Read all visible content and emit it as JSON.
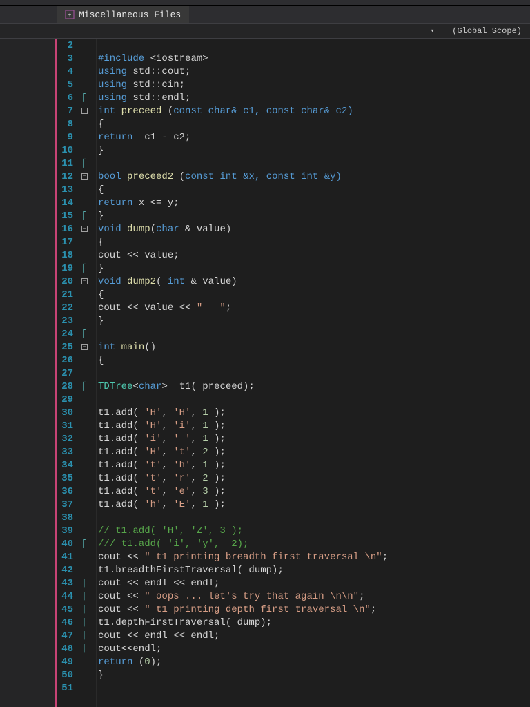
{
  "tab": {
    "label": "Miscellaneous Files"
  },
  "scope": {
    "label": "(Global Scope)"
  },
  "lines": {
    "start": 2,
    "end": 51
  },
  "code": {
    "l3": {
      "include": "#include",
      "lt": "<",
      "lib": "iostream",
      "gt": ">"
    },
    "l4": {
      "using": "using",
      "ns": "std::cout",
      "semi": ";"
    },
    "l5": {
      "using": "using",
      "ns": "std::cin",
      "semi": ";"
    },
    "l6": {
      "using": "using",
      "ns": "std::endl",
      "semi": ";"
    },
    "l7": {
      "type": "int",
      "fn": "preceed",
      "sig1": " (",
      "const1": "const",
      "char1": " char& c1, ",
      "const2": "const",
      "char2": " char& c2)"
    },
    "l8": {
      "brace": "{"
    },
    "l9": {
      "ret": "return",
      "expr": "  c1 - c2;"
    },
    "l10": {
      "brace": "}"
    },
    "l12": {
      "type": "bool",
      "fn": "preceed2",
      "sig1": " (",
      "const1": "const",
      "sig2": " int &x, ",
      "const2": "const",
      "sig3": " int &y)"
    },
    "l13": {
      "brace": "{"
    },
    "l14": {
      "ret": "return",
      "expr": " x <= y;"
    },
    "l15": {
      "brace": "}"
    },
    "l16": {
      "type": "void",
      "fn": "dump",
      "sig": "(",
      "ptype": "char",
      "rest": " & value)"
    },
    "l17": {
      "brace": "{"
    },
    "l18": {
      "out": "cout << value;"
    },
    "l19": {
      "brace": "}"
    },
    "l20": {
      "type": "void",
      "fn": "dump2",
      "sig": "( ",
      "ptype": "int",
      "rest": " & value)"
    },
    "l21": {
      "brace": "{"
    },
    "l22": {
      "out1": "cout << value << ",
      "str": "\"   \"",
      "out2": ";"
    },
    "l23": {
      "brace": "}"
    },
    "l25": {
      "type": "int",
      "fn": "main",
      "sig": "()"
    },
    "l26": {
      "brace": "{"
    },
    "l28": {
      "cls": "TDTree",
      "tpl1": "<",
      "tparam": "char",
      "tpl2": ">",
      "rest": "  t1( preceed);"
    },
    "l30": {
      "obj": "t1.add( ",
      "a": "'H'",
      "c1": ", ",
      "b": "'H'",
      "c2": ", ",
      "n": "1",
      "end": " );"
    },
    "l31": {
      "obj": "t1.add( ",
      "a": "'H'",
      "c1": ", ",
      "b": "'i'",
      "c2": ", ",
      "n": "1",
      "end": " );"
    },
    "l32": {
      "obj": "t1.add( ",
      "a": "'i'",
      "c1": ", ",
      "b": "' '",
      "c2": ", ",
      "n": "1",
      "end": " );"
    },
    "l33": {
      "obj": "t1.add( ",
      "a": "'H'",
      "c1": ", ",
      "b": "'t'",
      "c2": ", ",
      "n": "2",
      "end": " );"
    },
    "l34": {
      "obj": "t1.add( ",
      "a": "'t'",
      "c1": ", ",
      "b": "'h'",
      "c2": ", ",
      "n": "1",
      "end": " );"
    },
    "l35": {
      "obj": "t1.add( ",
      "a": "'t'",
      "c1": ", ",
      "b": "'r'",
      "c2": ", ",
      "n": "2",
      "end": " );"
    },
    "l36": {
      "obj": "t1.add( ",
      "a": "'t'",
      "c1": ", ",
      "b": "'e'",
      "c2": ", ",
      "n": "3",
      "end": " );"
    },
    "l37": {
      "obj": "t1.add( ",
      "a": "'h'",
      "c1": ", ",
      "b": "'E'",
      "c2": ", ",
      "n": "1",
      "end": " );"
    },
    "l39": {
      "cmt": "// t1.add( 'H', 'Z', 3 );"
    },
    "l40": {
      "cmt": "/// t1.add( 'i', 'y',  2);"
    },
    "l41": {
      "out1": "cout << ",
      "str": "\" t1 printing breadth first traversal \\n\"",
      "out2": ";"
    },
    "l42": {
      "call": "t1.breadthFirstTraversal( dump);"
    },
    "l43": {
      "out": "cout << endl << endl;"
    },
    "l44": {
      "out1": "cout << ",
      "str": "\" oops ... let's try that again \\n\\n\"",
      "out2": ";"
    },
    "l45": {
      "out1": "cout << ",
      "str": "\" t1 printing depth first traversal \\n\"",
      "out2": ";"
    },
    "l46": {
      "call": "t1.depthFirstTraversal( dump);"
    },
    "l47": {
      "out": "cout << endl << endl;"
    },
    "l48": {
      "out": "cout<<endl;"
    },
    "l49": {
      "ret": "return",
      "rest": " (",
      "n": "0",
      "end": ");"
    },
    "l50": {
      "brace": "}"
    }
  }
}
